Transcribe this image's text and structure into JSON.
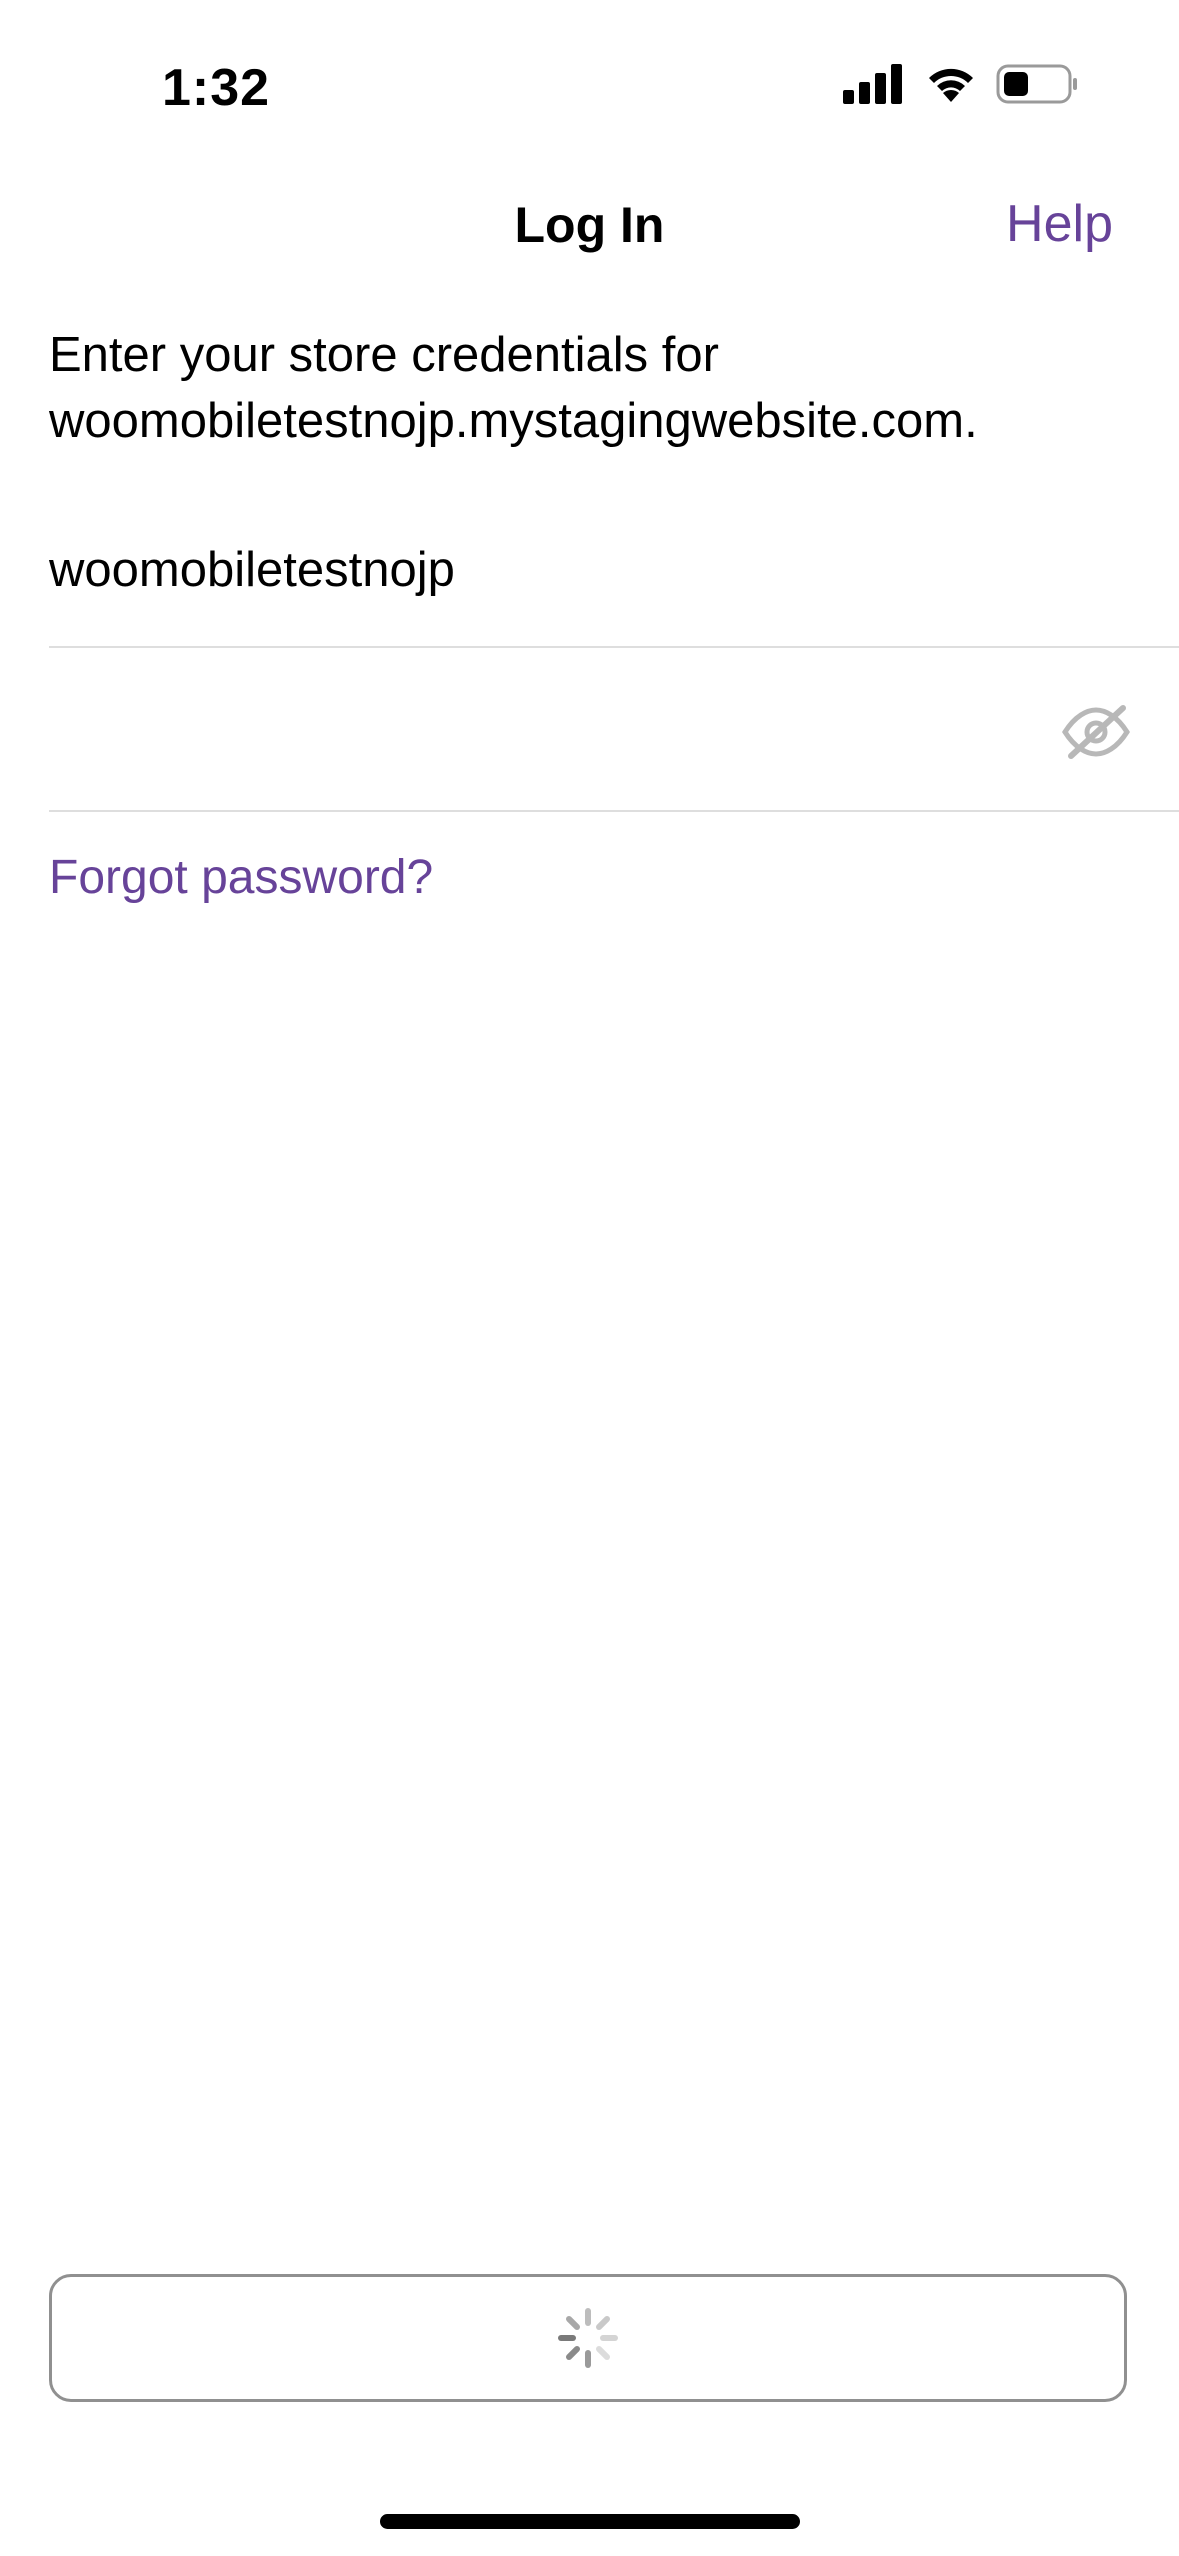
{
  "status_bar": {
    "time": "1:32",
    "icons": [
      "signal-icon",
      "wifi-icon",
      "battery-icon"
    ]
  },
  "nav": {
    "title": "Log In",
    "help_label": "Help"
  },
  "instructions": "Enter your store credentials for woomobiletestnojp.mystagingwebsite.com.",
  "form": {
    "username_value": "woomobiletestnojp",
    "password_value": "",
    "password_toggle_icon": "eye-slash-icon",
    "forgot_password_label": "Forgot password?"
  },
  "submit": {
    "state": "loading",
    "icon": "spinner-icon"
  },
  "colors": {
    "accent": "#674399",
    "divider": "#dedede",
    "button_border": "#909090"
  }
}
